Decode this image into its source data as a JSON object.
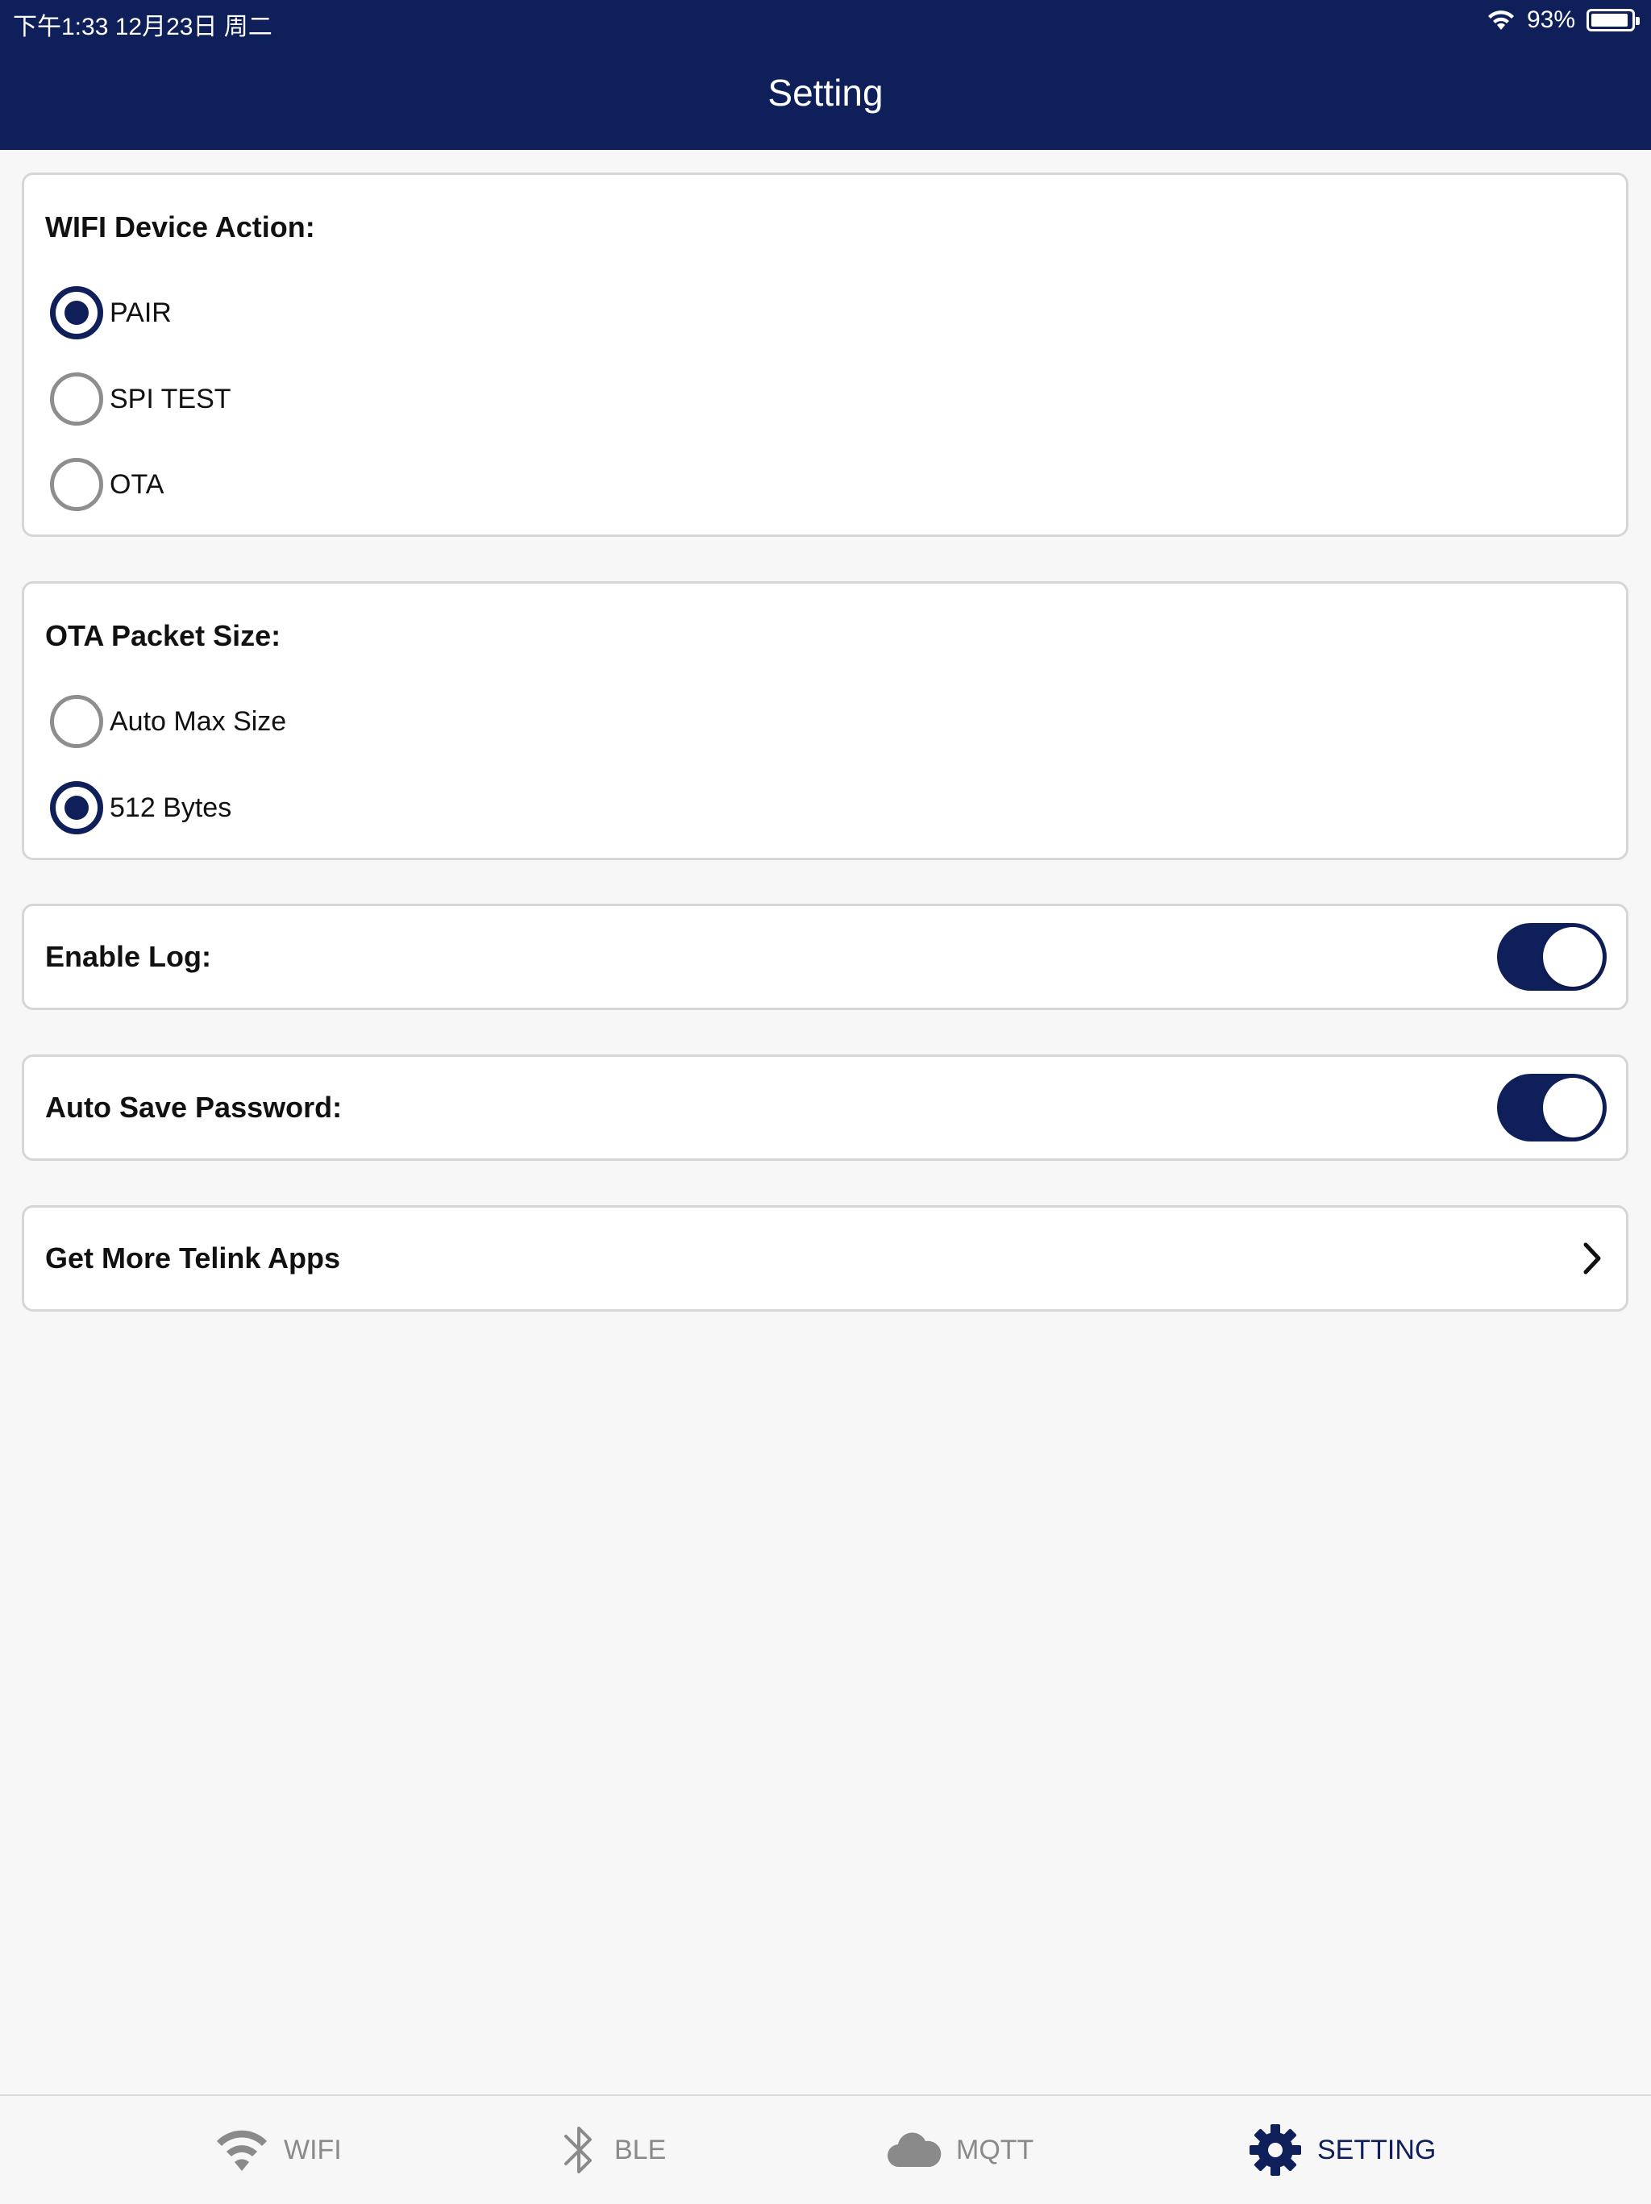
{
  "status_bar": {
    "time": "下午1:33   12月23日 周二",
    "battery_percent": "93%",
    "battery_level": 0.93
  },
  "header": {
    "title": "Setting"
  },
  "wifi_action": {
    "title": "WIFI Device Action:",
    "options": [
      {
        "label": "PAIR",
        "checked": true
      },
      {
        "label": "SPI TEST",
        "checked": false
      },
      {
        "label": "OTA",
        "checked": false
      }
    ]
  },
  "ota_packet": {
    "title": "OTA Packet Size:",
    "options": [
      {
        "label": "Auto Max Size",
        "checked": false
      },
      {
        "label": "512 Bytes",
        "checked": true
      }
    ]
  },
  "enable_log": {
    "label": "Enable Log:",
    "on": true
  },
  "auto_save_password": {
    "label": "Auto Save Password:",
    "on": true
  },
  "more_apps": {
    "label": "Get More Telink Apps"
  },
  "tabbar": {
    "tabs": [
      {
        "label": "WIFI",
        "icon": "wifi-icon",
        "active": false
      },
      {
        "label": "BLE",
        "icon": "bluetooth-icon",
        "active": false
      },
      {
        "label": "MQTT",
        "icon": "cloud-icon",
        "active": false
      },
      {
        "label": "SETTING",
        "icon": "gear-icon",
        "active": true
      }
    ]
  },
  "colors": {
    "primary": "#0f1f5a",
    "background": "#f7f7f7",
    "inactive": "#8a8a8a"
  }
}
